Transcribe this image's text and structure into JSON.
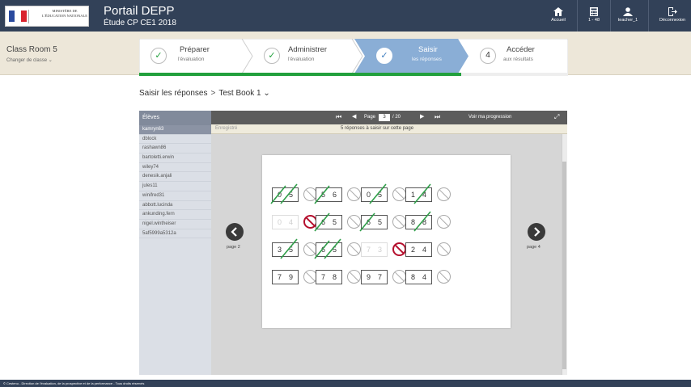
{
  "header": {
    "logo_text": "MINISTÈRE DE L'ÉDUCATION NATIONALE",
    "title": "Portail DEPP",
    "subtitle": "Étude CP CE1 2018",
    "nav": [
      {
        "icon": "home-icon",
        "label": "Accueil"
      },
      {
        "icon": "calculator-icon",
        "label": "1 - 48"
      },
      {
        "icon": "user-icon",
        "label": "teacher_1"
      },
      {
        "icon": "logout-icon",
        "label": "Déconnexion"
      }
    ],
    "colors": {
      "bar": "#324158",
      "accent": "#22a03d",
      "active": "#8aaed6"
    }
  },
  "class_bar": {
    "name": "Class Room 5",
    "change_label": "Changer de classe"
  },
  "steps": [
    {
      "t1": "Préparer",
      "t2": "l'évaluation",
      "state": "done"
    },
    {
      "t1": "Administrer",
      "t2": "l'évaluation",
      "state": "done"
    },
    {
      "t1": "Saisir",
      "t2": "les réponses",
      "state": "active"
    },
    {
      "number": "4",
      "t1": "Accéder",
      "t2": "aux résultats",
      "state": "todo"
    }
  ],
  "breadcrumb": {
    "root": "Saisir les réponses",
    "sep": ">",
    "book": "Test Book 1"
  },
  "students": {
    "header": "Élèves",
    "items": [
      "kamryn63",
      "dblock",
      "rashawn86",
      "bartoletti.erwin",
      "wiley74",
      "denesik.anjali",
      "jules11",
      "winifred31",
      "abbott.lucinda",
      "ankunding.fern",
      "nigel.wintheiser",
      "5af5999a5312a"
    ]
  },
  "viewer": {
    "page_label": "Page",
    "page_value": "3",
    "page_total": "/ 20",
    "progress_button": "Voir ma progression",
    "status_saved": "Enregistré",
    "status_message": "5 réponses à saisir sur cette page",
    "prev_label": "page 2",
    "next_label": "page 4"
  },
  "grid": [
    [
      {
        "a": "0",
        "b": "5",
        "s": "cross-both",
        "st": "neutral"
      },
      {
        "a": "5",
        "b": "6",
        "s": "cross-left",
        "st": "neutral"
      },
      {
        "a": "0",
        "b": "5",
        "s": "cross-right",
        "st": "neutral"
      },
      {
        "a": "1",
        "b": "4",
        "s": "cross-right",
        "st": "neutral"
      }
    ],
    [
      {
        "a": "0",
        "b": "4",
        "s": "none",
        "st": "missing"
      },
      {
        "a": "6",
        "b": "5",
        "s": "cross-left",
        "st": "neutral"
      },
      {
        "a": "6",
        "b": "5",
        "s": "cross-left",
        "st": "neutral"
      },
      {
        "a": "8",
        "b": "8",
        "s": "cross-right",
        "st": "neutral"
      }
    ],
    [
      {
        "a": "3",
        "b": "5",
        "s": "cross-right",
        "st": "neutral"
      },
      {
        "a": "6",
        "b": "5",
        "s": "cross-both",
        "st": "neutral"
      },
      {
        "a": "7",
        "b": "3",
        "s": "none",
        "st": "missing"
      },
      {
        "a": "2",
        "b": "4",
        "s": "none",
        "st": "neutral"
      }
    ],
    [
      {
        "a": "7",
        "b": "9",
        "s": "none",
        "st": "neutral"
      },
      {
        "a": "7",
        "b": "8",
        "s": "none",
        "st": "neutral"
      },
      {
        "a": "9",
        "b": "7",
        "s": "none",
        "st": "neutral"
      },
      {
        "a": "8",
        "b": "4",
        "s": "none",
        "st": "neutral"
      }
    ]
  ],
  "footer": {
    "text": "© Cestenu - Direction de l'évaluation, de la prospective et de la performance - Tous droits réservés"
  }
}
